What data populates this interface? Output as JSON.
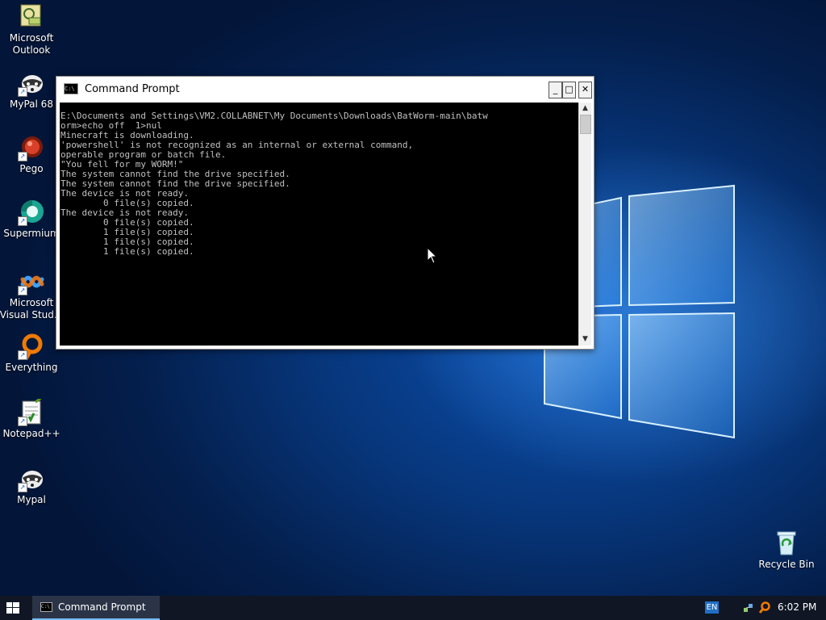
{
  "desktop": {
    "icons": [
      {
        "label": "Microsoft\nOutlook",
        "icon": "outlook-icon"
      },
      {
        "label": "MyPal 68",
        "icon": "raccoon-icon"
      },
      {
        "label": "Pego",
        "icon": "pego-icon"
      },
      {
        "label": "Supermium",
        "icon": "supermium-icon"
      },
      {
        "label": "Microsoft\nVisual Stud...",
        "icon": "visual-studio-icon"
      },
      {
        "label": "Everything",
        "icon": "everything-icon"
      },
      {
        "label": "Notepad++",
        "icon": "notepad-plus-plus-icon"
      },
      {
        "label": "Mypal",
        "icon": "raccoon-icon"
      }
    ],
    "recycle_bin": {
      "label": "Recycle Bin",
      "icon": "recycle-bin-icon"
    }
  },
  "window": {
    "title": "Command Prompt",
    "icon_text": "C:\\",
    "buttons": {
      "minimize": "_",
      "maximize": "□",
      "close": "✕"
    },
    "console_text": "E:\\Documents and Settings\\VM2.COLLABNET\\My Documents\\Downloads\\BatWorm-main\\batw\norm>echo off  1>nul\nMinecraft is downloading.\n'powershell' is not recognized as an internal or external command,\noperable program or batch file.\n\"You fell for my WORM!\"\nThe system cannot find the drive specified.\nThe system cannot find the drive specified.\nThe device is not ready.\n        0 file(s) copied.\nThe device is not ready.\n        0 file(s) copied.\n        1 file(s) copied.\n        1 file(s) copied.\n        1 file(s) copied."
  },
  "taskbar": {
    "items": [
      {
        "label": "Command Prompt",
        "icon_text": "C:\\"
      }
    ],
    "language": "EN",
    "clock": "6:02 PM"
  },
  "colors": {
    "console_bg": "#000000",
    "console_fg": "#c0c0c0",
    "taskbar_bg": "#101624",
    "accent": "#76b9ed"
  }
}
